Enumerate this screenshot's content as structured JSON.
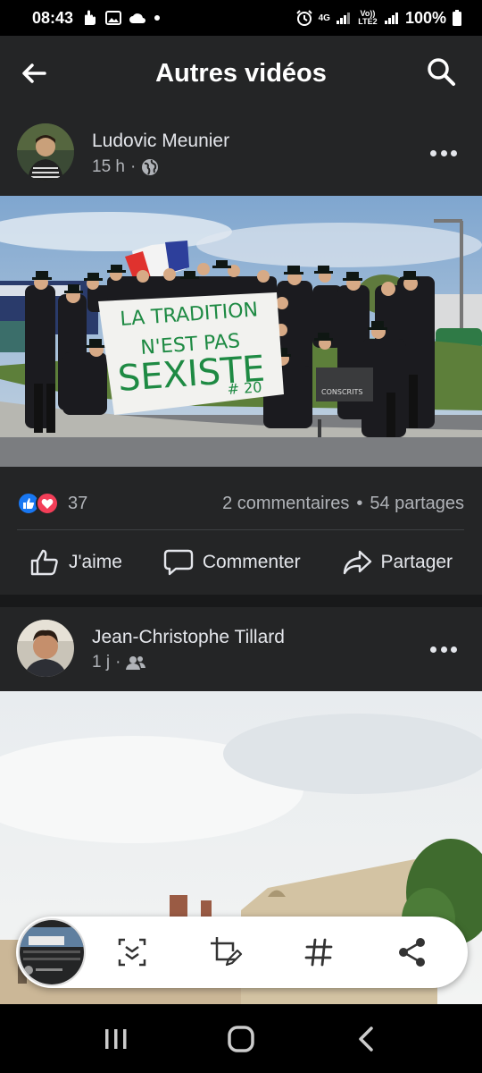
{
  "status_bar": {
    "time": "08:43",
    "network_4g": "4G",
    "volte": "Vo)) LTE2",
    "battery": "100%"
  },
  "app_bar": {
    "title": "Autres vidéos"
  },
  "post1": {
    "author": "Ludovic Meunier",
    "time": "15 h",
    "privacy_icon": "globe-icon",
    "banner_text_line1": "LA TRADITION",
    "banner_text_line2": "N'EST PAS",
    "banner_text_line3": "SEXISTE",
    "banner_text_line4": "# 20",
    "sign_text": "CONSCRITS",
    "reaction_count": "37",
    "comments": "2 commentaires",
    "dot": "•",
    "shares": "54 partages",
    "like_label": "J'aime",
    "comment_label": "Commenter",
    "share_label": "Partager"
  },
  "post2": {
    "author": "Jean-Christophe Tillard",
    "time": "1 j",
    "privacy_icon": "friends-icon"
  },
  "colors": {
    "like_blue": "#1877f2",
    "love_red": "#f33e58",
    "surface": "#242526",
    "background": "#18191a"
  }
}
